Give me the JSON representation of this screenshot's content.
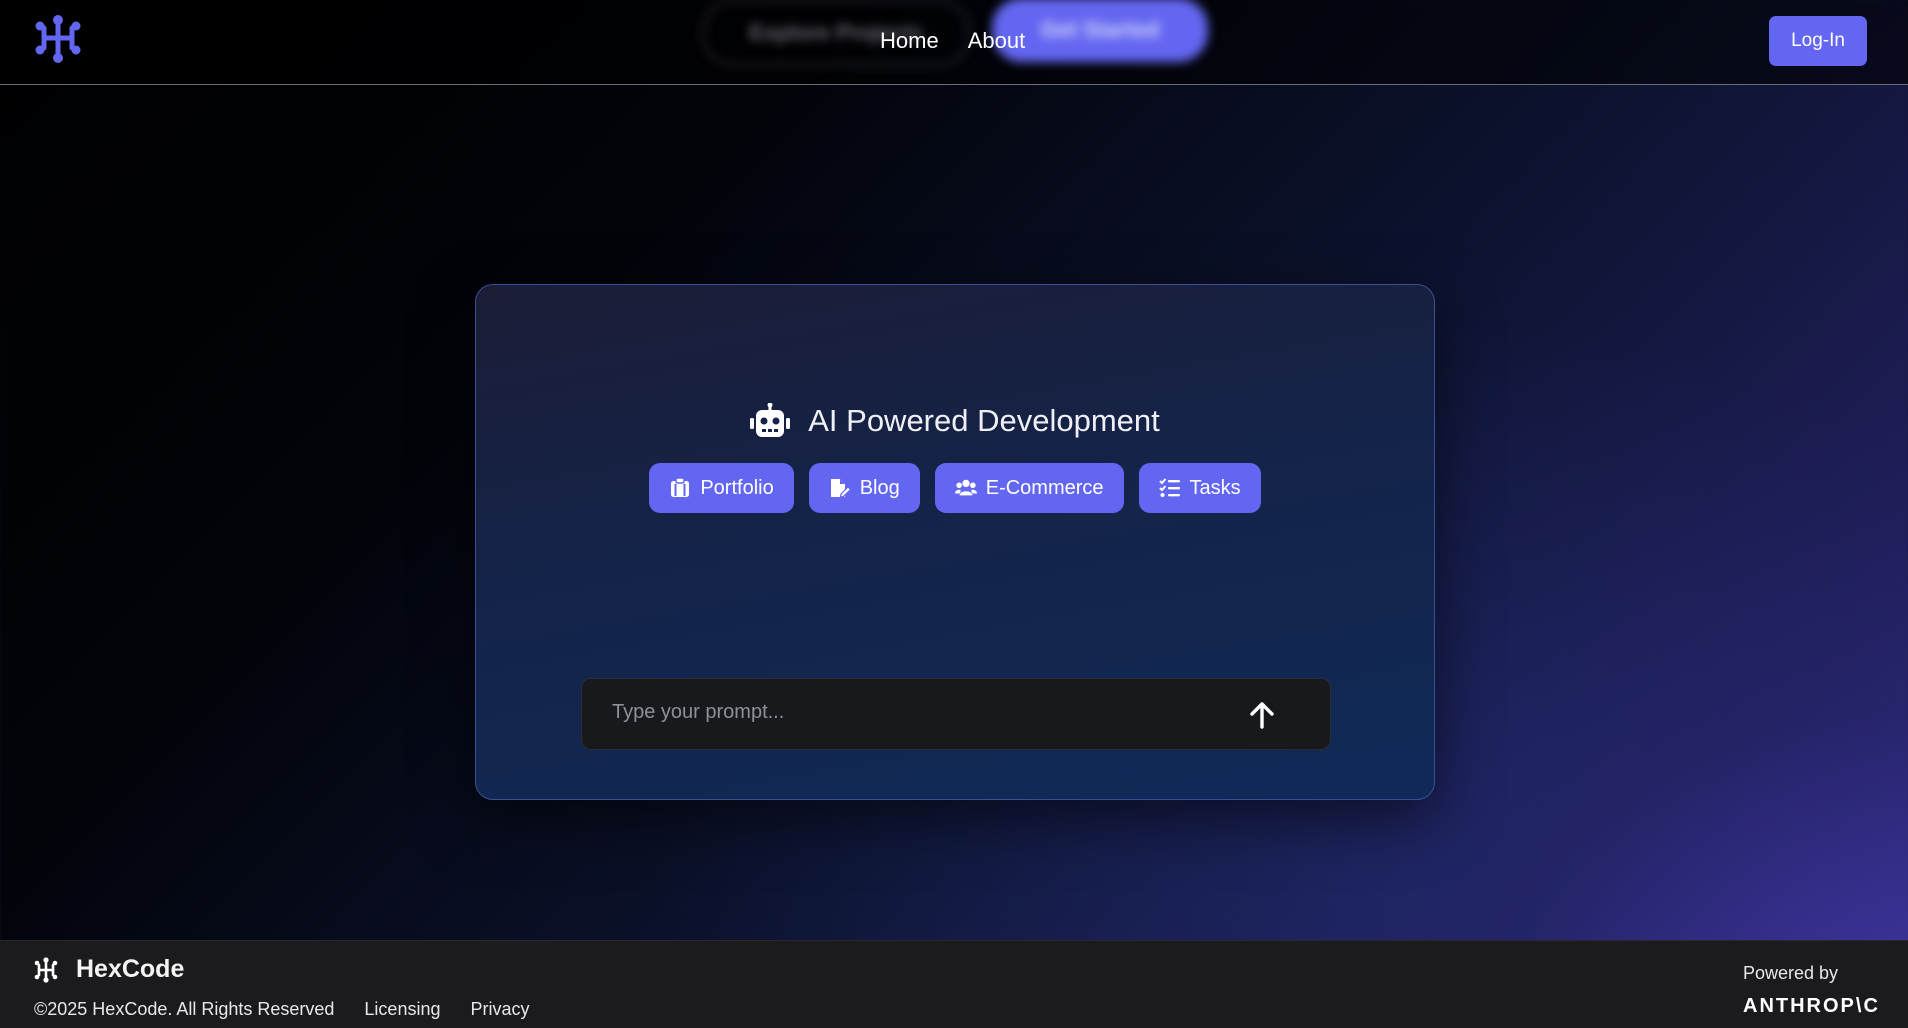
{
  "header": {
    "nav": [
      {
        "label": "Home"
      },
      {
        "label": "About"
      }
    ],
    "login_label": "Log-In",
    "blurred_buttons": [
      "Explore Projects",
      "Get Started"
    ]
  },
  "hero": {
    "title": "AI Powered Development",
    "chips": [
      {
        "label": "Portfolio",
        "icon": "clipboard-icon"
      },
      {
        "label": "Blog",
        "icon": "file-pen-icon"
      },
      {
        "label": "E-Commerce",
        "icon": "users-icon"
      },
      {
        "label": "Tasks",
        "icon": "list-check-icon"
      }
    ],
    "prompt_placeholder": "Type your prompt..."
  },
  "footer": {
    "brand": "HexCode",
    "copyright": "©2025 HexCode. All Rights Reserved",
    "links": [
      "Licensing",
      "Privacy"
    ],
    "powered_by": "Powered by",
    "provider": "ANTHROP\\C"
  },
  "colors": {
    "accent": "#6366f1",
    "footer_bg": "#1b1b1d",
    "input_bg": "#18191c"
  }
}
